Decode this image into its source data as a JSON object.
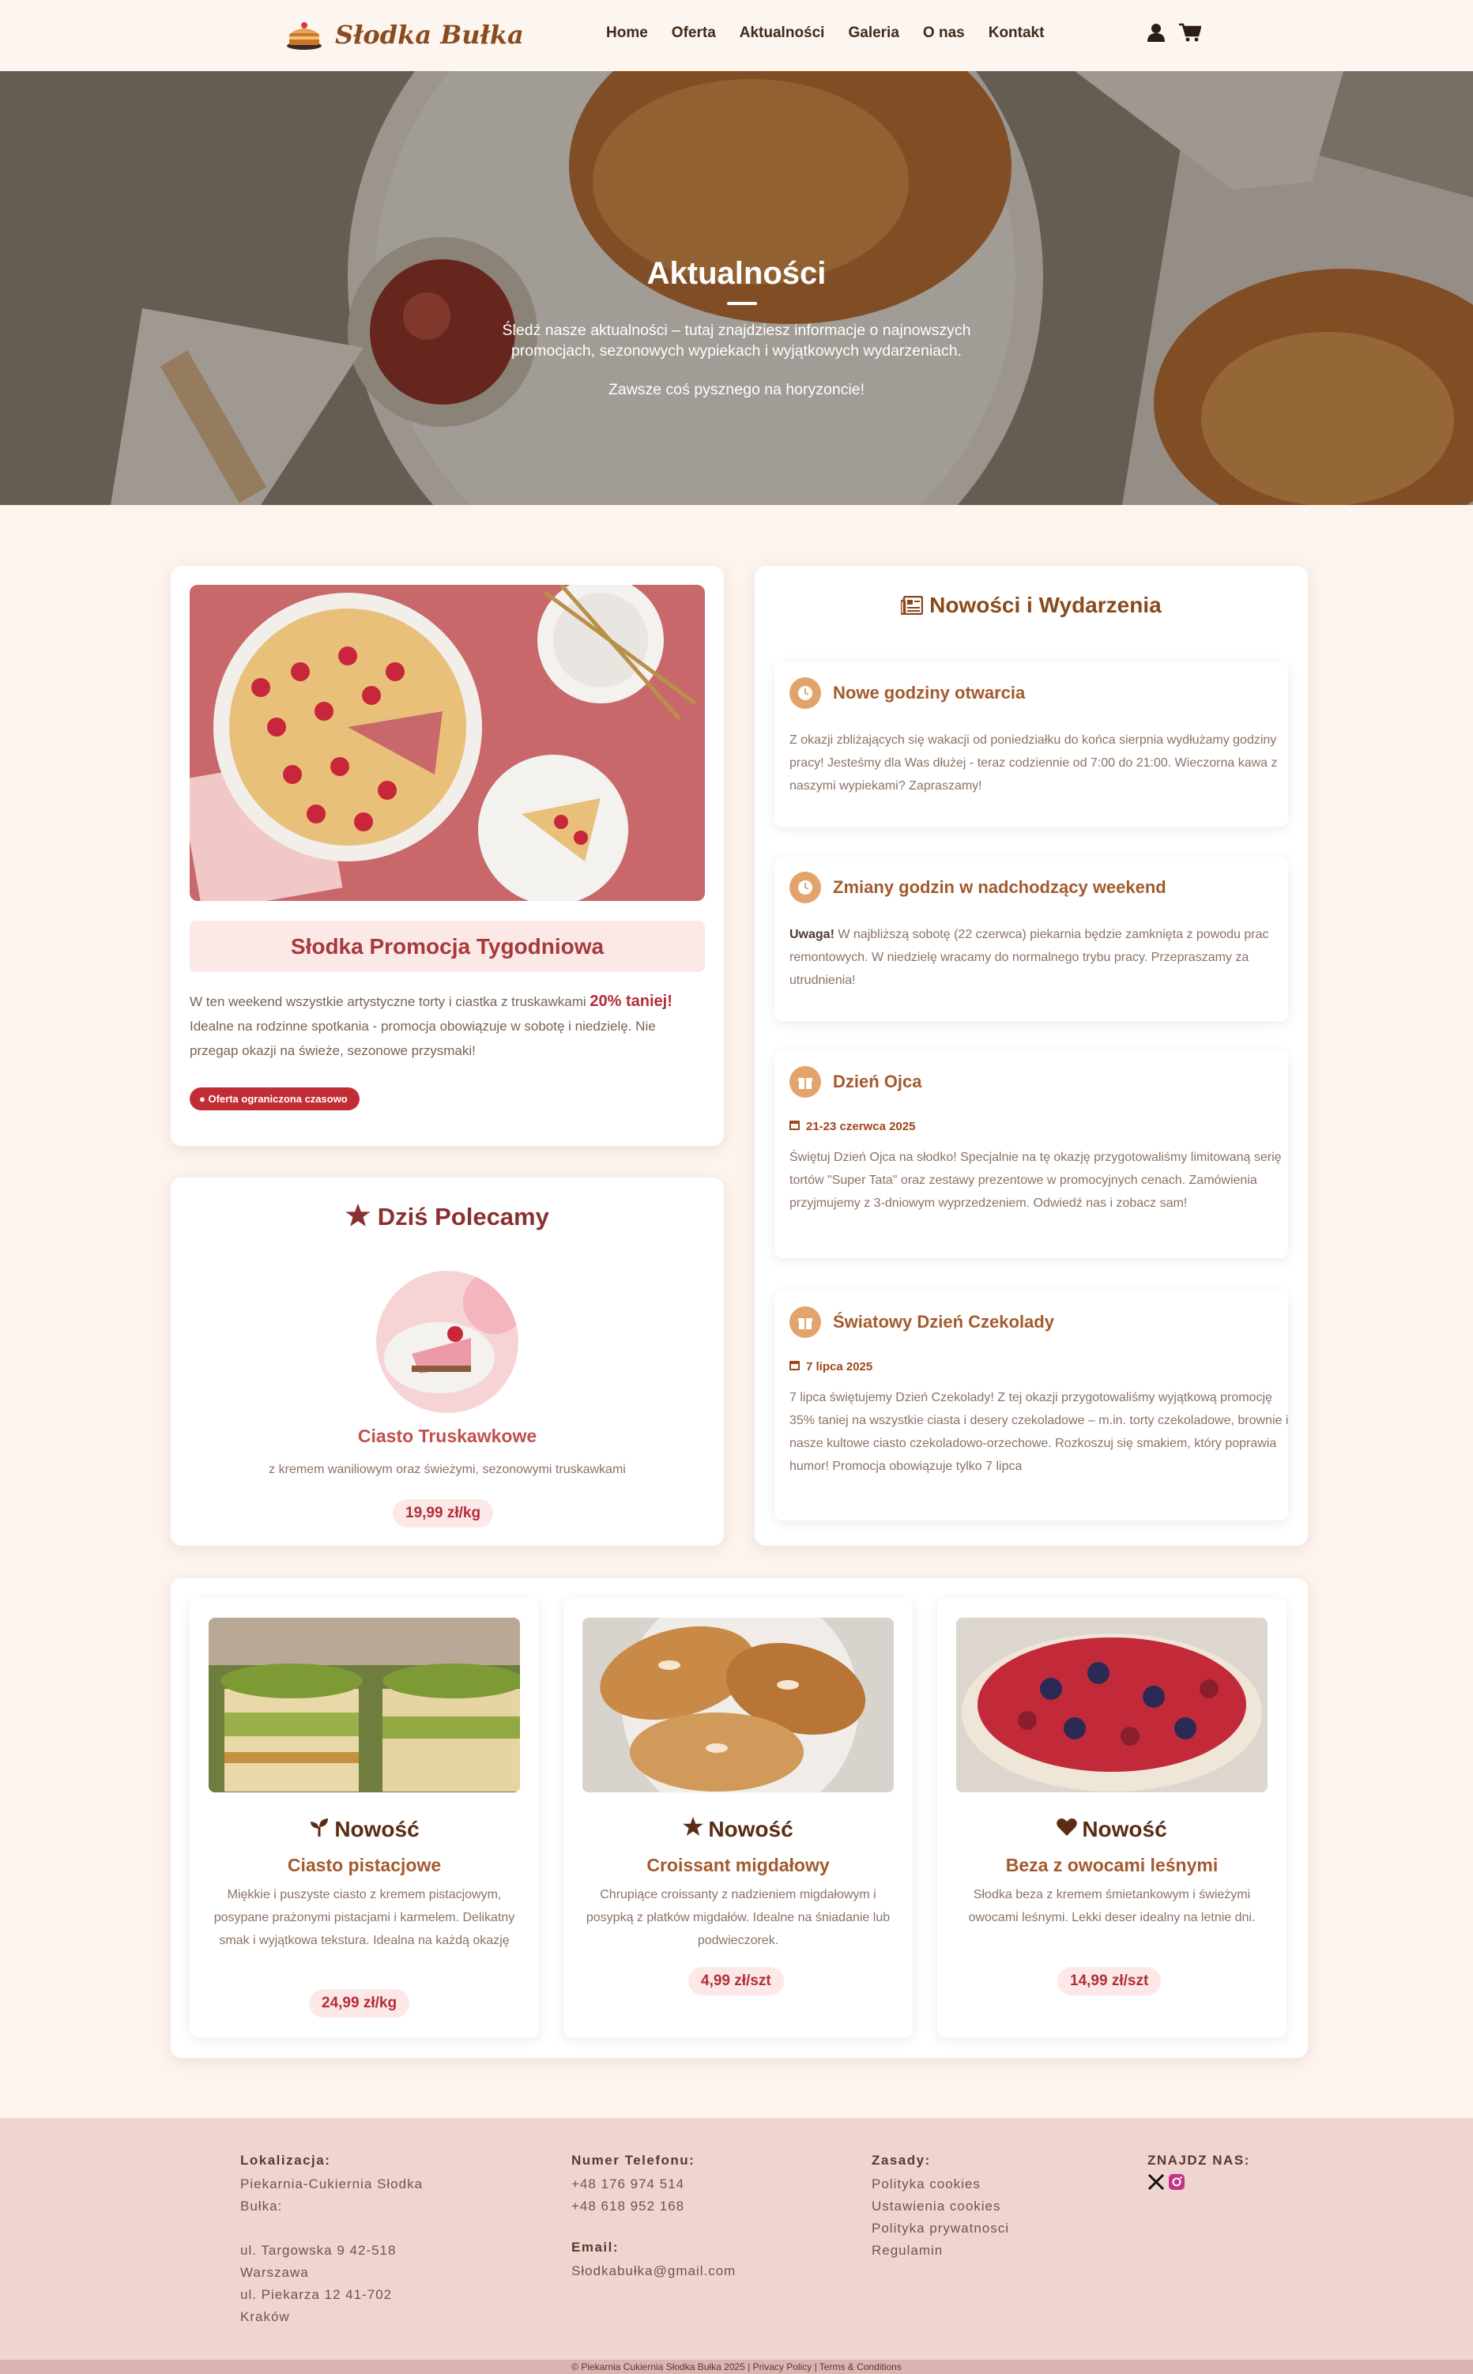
{
  "brand": {
    "name": "Słodka Bułka"
  },
  "nav": {
    "items": [
      "Home",
      "Oferta",
      "Aktualności",
      "Galeria",
      "O nas",
      "Kontakt"
    ],
    "icons": [
      "user-icon",
      "cart-icon"
    ]
  },
  "hero": {
    "title": "Aktualności",
    "text": "Śledź nasze aktualności – tutaj znajdziesz informacje o najnowszych promocjach, sezonowych wypiekach i wyjątkowych wydarzeniach.",
    "text2": "Zawsze coś pysznego na horyzoncie!"
  },
  "promo": {
    "title": "Słodka Promocja Tygodniowa",
    "text_before": "W ten weekend wszystkie artystyczne torty i ciastka z truskawkami ",
    "highlight": "20% taniej!",
    "text_after": " Idealne na rodzinne spotkania - promocja obowiązuje w sobotę i niedzielę. Nie przegap okazji na świeże, sezonowe przysmaki!",
    "badge": "Oferta ograniczona czasowo"
  },
  "recommend": {
    "title": "Dziś Polecamy",
    "name": "Ciasto Truskawkowe",
    "desc": "z kremem waniliowym oraz świeżymi, sezonowymi truskawkami",
    "price": "19,99 zł/kg"
  },
  "news": {
    "title": "Nowości i Wydarzenia",
    "events": [
      {
        "icon": "clock-icon",
        "title": "Nowe godziny otwarcia",
        "date": "",
        "bold": "",
        "text": "Z okazji zbliżających się wakacji od poniedziałku do końca sierpnia wydłużamy godziny pracy! Jesteśmy dla Was dłużej - teraz codziennie od 7:00 do 21:00. Wieczorna kawa z naszymi wypiekami? Zapraszamy!"
      },
      {
        "icon": "clock-icon",
        "title": "Zmiany godzin w nadchodzący weekend",
        "date": "",
        "bold": "Uwaga!",
        "text": " W najbliższą sobotę (22 czerwca) piekarnia będzie zamknięta z powodu prac remontowych. W niedzielę wracamy do normalnego trybu pracy. Przepraszamy za utrudnienia!"
      },
      {
        "icon": "gift-icon",
        "title": "Dzień Ojca",
        "date": "21-23 czerwca 2025",
        "bold": "",
        "text": "Świętuj Dzień Ojca na słodko! Specjalnie na tę okazję przygotowaliśmy limitowaną serię tortów \"Super Tata\" oraz zestawy prezentowe w promocyjnych cenach. Zamówienia przyjmujemy z 3-dniowym wyprzedzeniem. Odwiedź nas i zobacz sam!"
      },
      {
        "icon": "gift-icon",
        "title": "Światowy Dzień Czekolady",
        "date": "7 lipca 2025",
        "bold": "",
        "text": "7 lipca świętujemy Dzień Czekolady! Z tej okazji przygotowaliśmy wyjątkową promocję 35% taniej na wszystkie ciasta i desery czekoladowe – m.in. torty czekoladowe, brownie i nasze kultowe ciasto czekoladowo-orzechowe. Rozkoszuj się smakiem, który poprawia humor! Promocja obowiązuje tylko 7 lipca"
      }
    ]
  },
  "products": [
    {
      "icon": "seedling-icon",
      "label": "Nowość",
      "name": "Ciasto pistacjowe",
      "desc": "Miękkie i puszyste ciasto z kremem pistacjowym, posypane prażonymi pistacjami i karmelem. Delikatny smak i wyjątkowa tekstura. Idealna na każdą okazję",
      "price": "24,99 zł/kg"
    },
    {
      "icon": "star-icon",
      "label": "Nowość",
      "name": "Croissant migdałowy",
      "desc": "Chrupiące croissanty z nadzieniem migdałowym i posypką z płatków migdałów. Idealne na śniadanie lub podwieczorek.",
      "price": "4,99 zł/szt"
    },
    {
      "icon": "heart-icon",
      "label": "Nowość",
      "name": "Beza z owocami leśnymi",
      "desc": "Słodka beza z kremem śmietankowym i świeżymi owocami leśnymi. Lekki deser idealny na letnie dni.",
      "price": "14,99 zł/szt"
    }
  ],
  "footer": {
    "location": {
      "title": "Lokalizacja:",
      "lines": [
        "Piekarnia-Cukiernia Słodka",
        "Bułka:",
        "",
        "ul. Targowska 9 42-518",
        "Warszawa",
        "ul. Piekarza 12 41-702",
        "Kraków"
      ]
    },
    "phone": {
      "title": "Numer Telefonu:",
      "lines": [
        "+48 176 974 514",
        "+48 618 952 168"
      ],
      "email_title": "Email:",
      "email": "Słodkabułka@gmail.com"
    },
    "rules": {
      "title": "Zasady:",
      "lines": [
        "Polityka cookies",
        "Ustawienia cookies",
        "Polityka prywatnosci",
        "Regulamin"
      ]
    },
    "social": {
      "title": "ZNAJDZ NAS:",
      "icons": [
        "x-icon",
        "instagram-icon"
      ]
    },
    "copyright": "© Piekarnia Cukiernia Słodka Bułka 2025 | Privacy Policy | Terms & Conditions"
  }
}
